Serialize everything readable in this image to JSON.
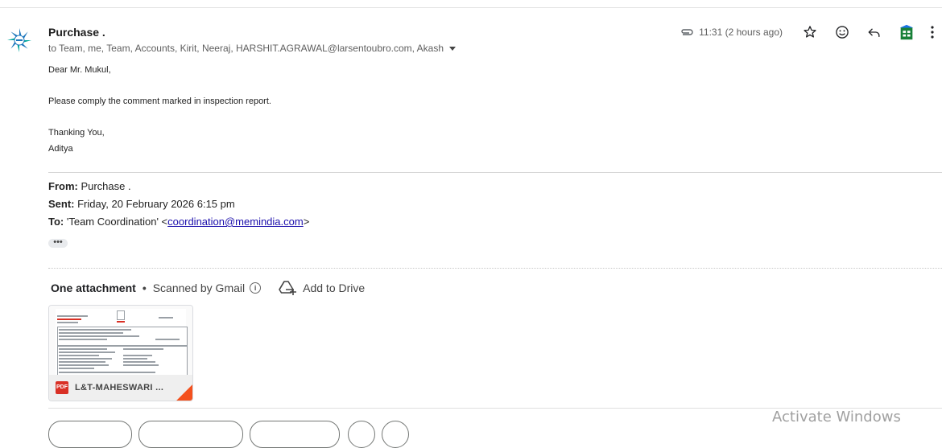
{
  "email": {
    "sender": "Purchase .",
    "recipients": "to Team, me, Team, Accounts, Kirit, Neeraj, HARSHIT.AGRAWAL@larsentoubro.com, Akash",
    "time": "11:31 (2 hours ago)",
    "body": {
      "greeting": "Dear Mr. Mukul,",
      "message": "Please comply the comment marked in inspection report.",
      "closing": "Thanking You,",
      "signature": "Aditya"
    },
    "quoted": {
      "from_label": "From:",
      "from_value": " Purchase .",
      "sent_label": "Sent:",
      "sent_value": " Friday, 20 February 2026 6:15 pm",
      "to_label": "To:",
      "to_prefix": " 'Team Coordination' <",
      "to_email": "coordination@memindia.com",
      "to_suffix": ">"
    },
    "ellipsis": "•••"
  },
  "attachments": {
    "title": "One attachment",
    "separator": "•",
    "scan_note": "Scanned by Gmail",
    "info_glyph": "i",
    "add_to_drive": "Add to Drive",
    "file": {
      "type_badge": "PDF",
      "name": "L&T-MAHESWARI ..."
    }
  },
  "system": {
    "watermark": "Activate Windows"
  },
  "icons": {
    "attachment": "paperclip-icon",
    "star": "star-icon",
    "emoji": "emoji-icon",
    "reply": "reply-icon",
    "sheets": "google-sheets-icon",
    "more": "more-vertical-icon",
    "drive": "add-to-drive-icon",
    "pdf": "pdf-file-icon"
  },
  "colors": {
    "link": "#1a0dab",
    "pdf_red": "#d93025",
    "sheets_green": "#188038",
    "sheets_blue": "#1a73e8"
  }
}
